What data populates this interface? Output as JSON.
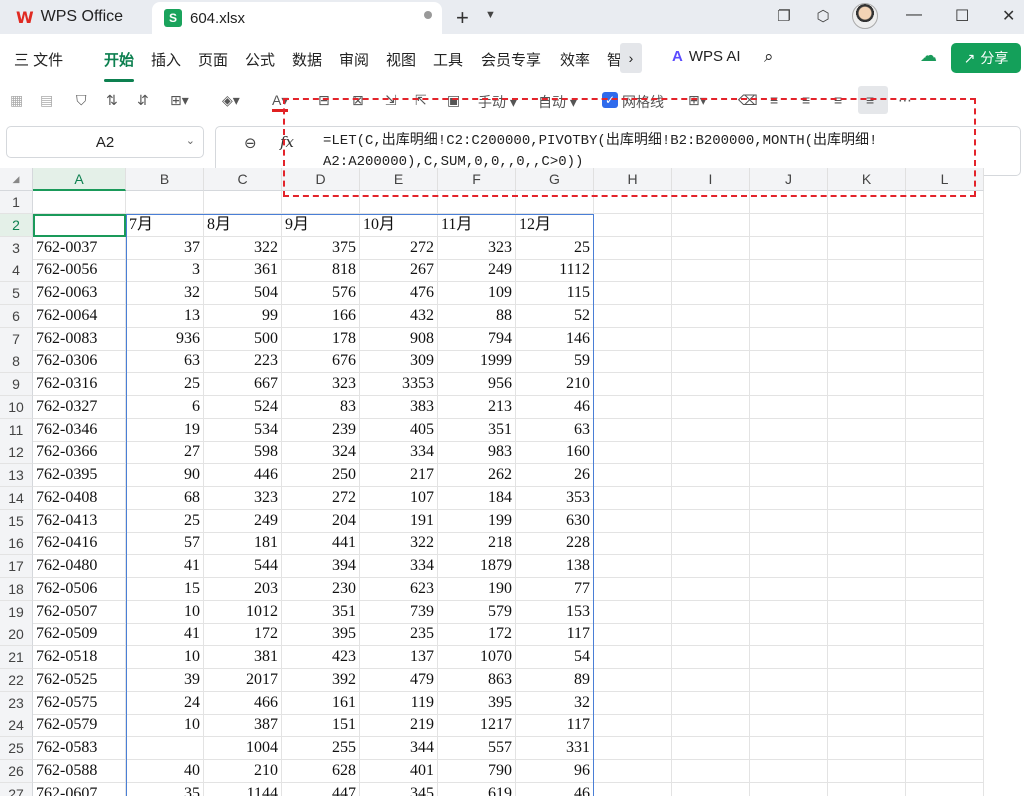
{
  "titlebar": {
    "app_tab": "WPS Office",
    "doc_tab": "604.xlsx"
  },
  "menu": {
    "items": [
      "三 文件",
      "开始",
      "插入",
      "页面",
      "公式",
      "数据",
      "审阅",
      "视图",
      "工具",
      "会员专享",
      "效率",
      "智"
    ],
    "active": "开始",
    "wps_ai": "WPS AI",
    "share": "分享"
  },
  "toolbar": {
    "manual": "手动",
    "auto": "自动",
    "gridlines": "网格线",
    "gridlines_checked": true
  },
  "formula_bar": {
    "name_box": "A2",
    "formula_line1": "=LET(C,出库明细!C2:C200000,PIVOTBY(出库明细!B2:B200000,MONTH(出库明细!",
    "formula_line2": "A2:A200000),C,SUM,0,0,,0,,C>0))"
  },
  "sheet": {
    "columns": [
      "A",
      "B",
      "C",
      "D",
      "E",
      "F",
      "G",
      "H",
      "I",
      "J",
      "K",
      "L"
    ],
    "selected_column": "A",
    "selected_row": "2",
    "row_numbers": [
      "1",
      "2",
      "3",
      "4",
      "5",
      "6",
      "7",
      "8",
      "9",
      "10",
      "11",
      "12",
      "13",
      "14",
      "15",
      "16",
      "17",
      "18",
      "19",
      "20",
      "21",
      "22",
      "23",
      "24",
      "25",
      "26",
      "27"
    ],
    "header_row": [
      "",
      "7月",
      "8月",
      "9月",
      "10月",
      "11月",
      "12月"
    ],
    "rows": [
      [
        "762-0037",
        "37",
        "322",
        "375",
        "272",
        "323",
        "25"
      ],
      [
        "762-0056",
        "3",
        "361",
        "818",
        "267",
        "249",
        "1112"
      ],
      [
        "762-0063",
        "32",
        "504",
        "576",
        "476",
        "109",
        "115"
      ],
      [
        "762-0064",
        "13",
        "99",
        "166",
        "432",
        "88",
        "52"
      ],
      [
        "762-0083",
        "936",
        "500",
        "178",
        "908",
        "794",
        "146"
      ],
      [
        "762-0306",
        "63",
        "223",
        "676",
        "309",
        "1999",
        "59"
      ],
      [
        "762-0316",
        "25",
        "667",
        "323",
        "3353",
        "956",
        "210"
      ],
      [
        "762-0327",
        "6",
        "524",
        "83",
        "383",
        "213",
        "46"
      ],
      [
        "762-0346",
        "19",
        "534",
        "239",
        "405",
        "351",
        "63"
      ],
      [
        "762-0366",
        "27",
        "598",
        "324",
        "334",
        "983",
        "160"
      ],
      [
        "762-0395",
        "90",
        "446",
        "250",
        "217",
        "262",
        "26"
      ],
      [
        "762-0408",
        "68",
        "323",
        "272",
        "107",
        "184",
        "353"
      ],
      [
        "762-0413",
        "25",
        "249",
        "204",
        "191",
        "199",
        "630"
      ],
      [
        "762-0416",
        "57",
        "181",
        "441",
        "322",
        "218",
        "228"
      ],
      [
        "762-0480",
        "41",
        "544",
        "394",
        "334",
        "1879",
        "138"
      ],
      [
        "762-0506",
        "15",
        "203",
        "230",
        "623",
        "190",
        "77"
      ],
      [
        "762-0507",
        "10",
        "1012",
        "351",
        "739",
        "579",
        "153"
      ],
      [
        "762-0509",
        "41",
        "172",
        "395",
        "235",
        "172",
        "117"
      ],
      [
        "762-0518",
        "10",
        "381",
        "423",
        "137",
        "1070",
        "54"
      ],
      [
        "762-0525",
        "39",
        "2017",
        "392",
        "479",
        "863",
        "89"
      ],
      [
        "762-0575",
        "24",
        "466",
        "161",
        "119",
        "395",
        "32"
      ],
      [
        "762-0579",
        "10",
        "387",
        "151",
        "219",
        "1217",
        "117"
      ],
      [
        "762-0583",
        "",
        "1004",
        "255",
        "344",
        "557",
        "331"
      ],
      [
        "762-0588",
        "40",
        "210",
        "628",
        "401",
        "790",
        "96"
      ],
      [
        "762-0607",
        "35",
        "1144",
        "447",
        "345",
        "619",
        "46"
      ]
    ]
  }
}
